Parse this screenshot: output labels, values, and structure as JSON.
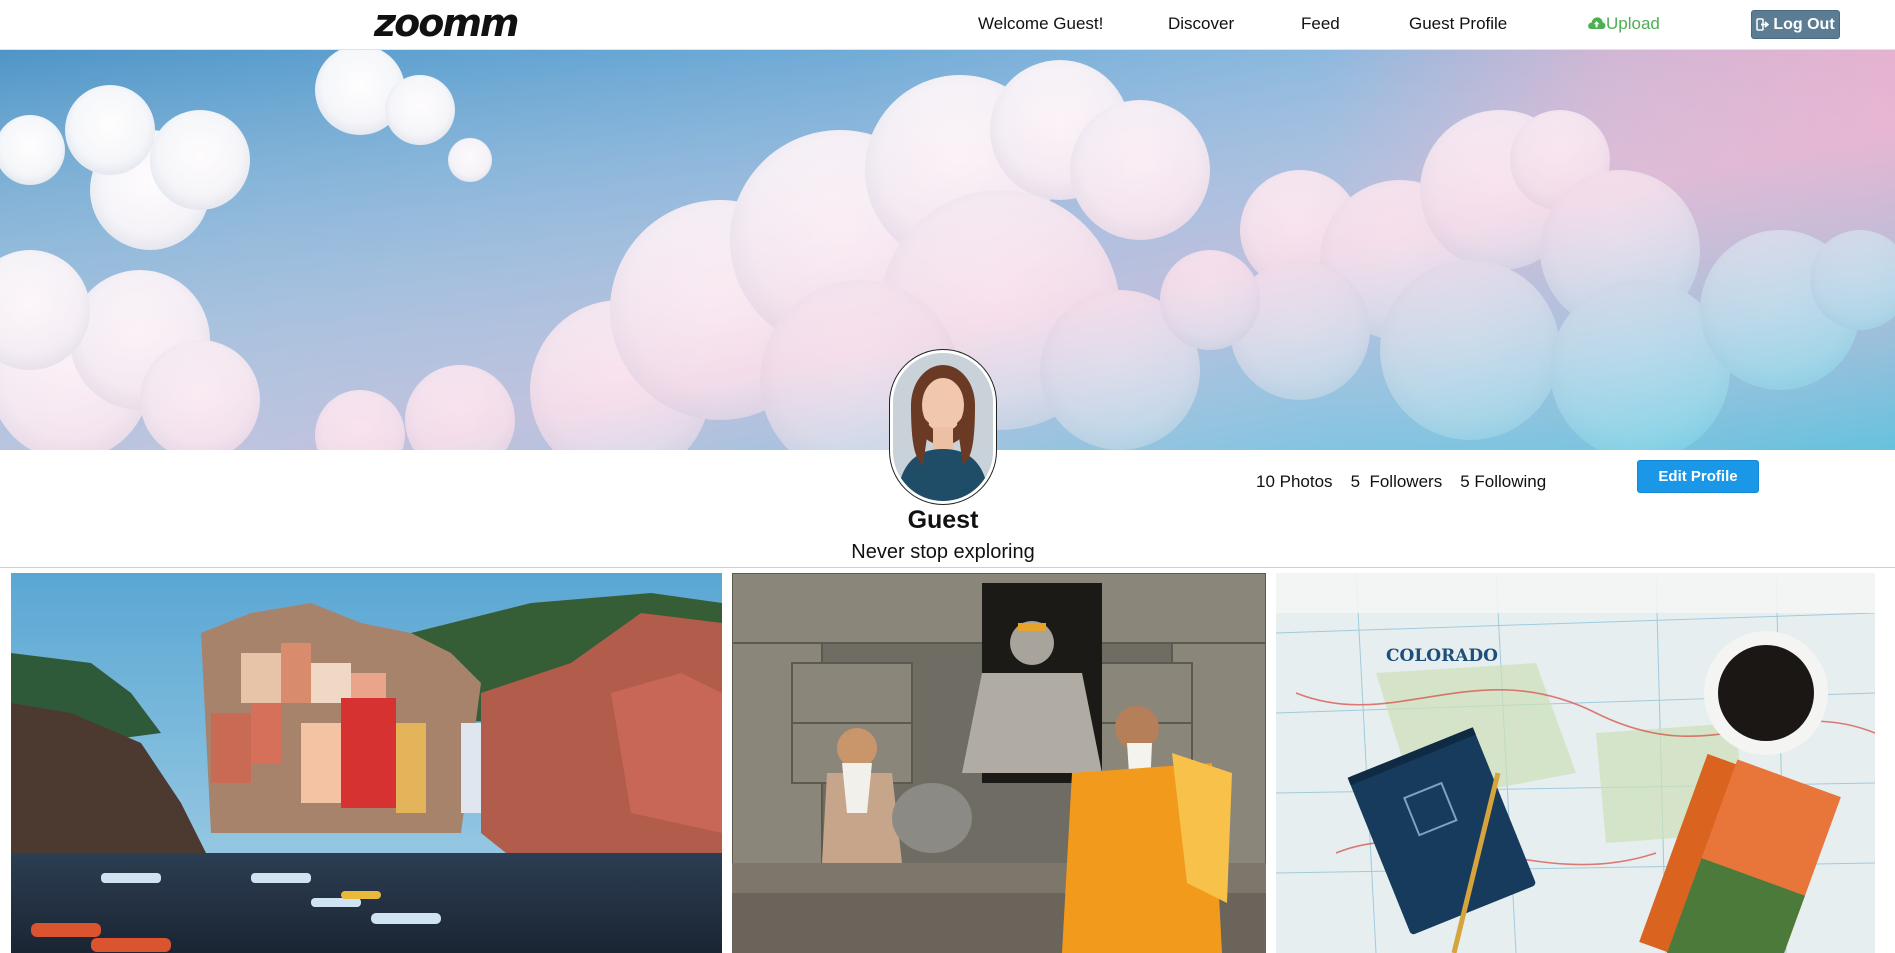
{
  "app": {
    "logo_text": "zoomm"
  },
  "nav": {
    "welcome": "Welcome Guest!",
    "discover": "Discover",
    "feed": "Feed",
    "profile": "Guest Profile",
    "upload": "Upload",
    "logout": "Log Out",
    "upload_icon": "cloud-upload-icon",
    "logout_icon": "sign-out-icon"
  },
  "profile": {
    "name": "Guest",
    "bio": "Never stop exploring",
    "stats": {
      "photos": "10 Photos",
      "followers": "5  Followers",
      "following": "5 Following"
    },
    "edit_label": "Edit Profile"
  },
  "gallery": {
    "photos": [
      {
        "subject": "colorful cliffside harbor village"
      },
      {
        "subject": "sadhus seated at temple steps"
      },
      {
        "subject": "travel maps with notebook and coffee"
      }
    ],
    "map_label": "COLORADO"
  },
  "colors": {
    "upload_green": "#4caf50",
    "logout_bg": "#5c7c94",
    "edit_blue": "#1a97e6"
  }
}
